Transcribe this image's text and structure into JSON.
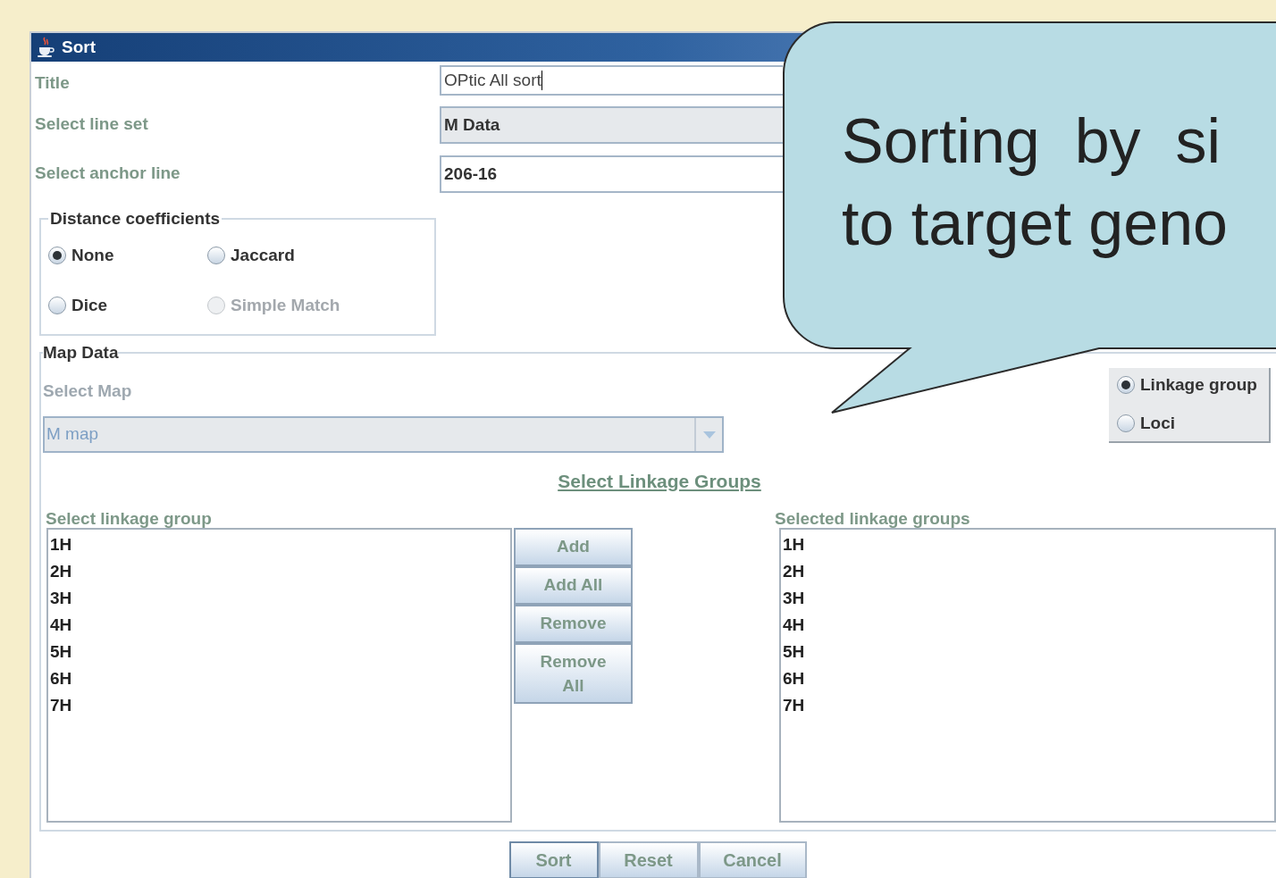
{
  "window": {
    "title": "Sort"
  },
  "fields": [
    {
      "kind": "text",
      "label": "Title",
      "value": "OPtic All sort",
      "focused": true
    },
    {
      "kind": "combo",
      "label": "Select line set",
      "value": "M Data",
      "focused": false
    },
    {
      "kind": "text",
      "label": "Select anchor line",
      "value": "206-16",
      "focused": false
    }
  ],
  "distance_coefficients": {
    "legend": "Distance coefficients",
    "options": [
      {
        "label": "None",
        "selected": true,
        "disabled": false
      },
      {
        "label": "Jaccard",
        "selected": false,
        "disabled": false
      },
      {
        "label": "Dice",
        "selected": false,
        "disabled": false
      },
      {
        "label": "Simple Match",
        "selected": false,
        "disabled": true
      }
    ]
  },
  "map_data": {
    "legend": "Map Data",
    "select_map": {
      "label": "Select Map",
      "value": "M map",
      "disabled": true
    },
    "mode_options": [
      {
        "label": "Linkage group",
        "selected": true
      },
      {
        "label": "Loci",
        "selected": false
      }
    ],
    "heading": "Select Linkage Groups",
    "available": {
      "label": "Select linkage group",
      "items": [
        "1H",
        "2H",
        "3H",
        "4H",
        "5H",
        "6H",
        "7H"
      ]
    },
    "transfer_buttons": [
      "Add",
      "Add All",
      "Remove",
      "Remove All"
    ],
    "chosen": {
      "label": "Selected linkage groups",
      "items": [
        "1H",
        "2H",
        "3H",
        "4H",
        "5H",
        "6H",
        "7H"
      ]
    }
  },
  "buttons": [
    {
      "label": "Sort",
      "focused": true
    },
    {
      "label": "Reset",
      "focused": false
    },
    {
      "label": "Cancel",
      "focused": false
    }
  ],
  "callout": {
    "lines": [
      "Sorting  by  si",
      "to target geno"
    ]
  }
}
